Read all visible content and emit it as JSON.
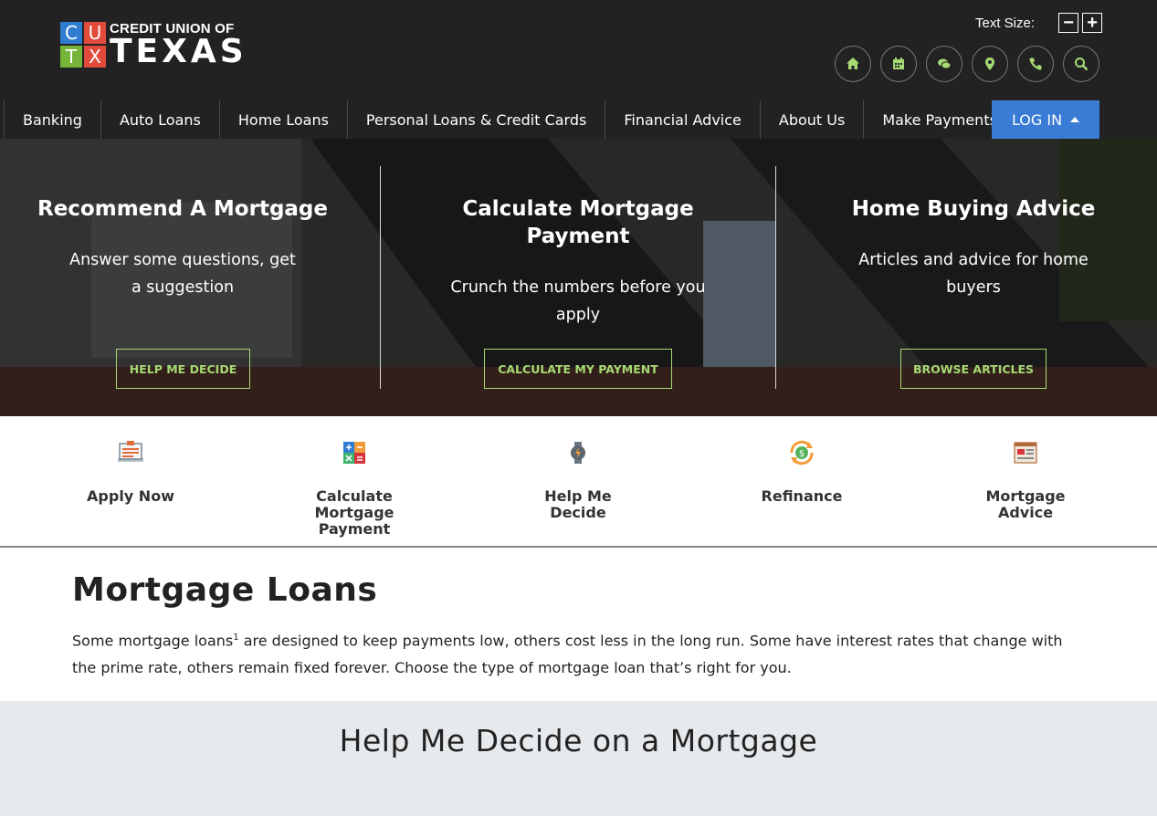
{
  "header": {
    "logo": {
      "cells": [
        "C",
        "U",
        "T",
        "X"
      ],
      "line1": "CREDIT UNION OF",
      "line2": "TEXAS"
    },
    "text_size": {
      "label": "Text Size:",
      "decrease": "−",
      "increase": "+"
    },
    "utility_icons": [
      "home-icon",
      "calendar-icon",
      "chat-icon",
      "location-icon",
      "phone-icon",
      "search-icon"
    ],
    "accent_color": "#a6d974"
  },
  "nav": {
    "items": [
      "Banking",
      "Auto Loans",
      "Home Loans",
      "Personal Loans & Credit Cards",
      "Financial Advice",
      "About Us",
      "Make Payments"
    ],
    "login": "LOG IN",
    "login_color": "#3a7bd5"
  },
  "hero": {
    "columns": [
      {
        "title": "Recommend A Mortgage",
        "text": "Answer some questions, get a suggestion",
        "button": "HELP ME DECIDE"
      },
      {
        "title": "Calculate Mortgage Payment",
        "text": "Crunch the numbers before you apply",
        "button": "CALCULATE MY PAYMENT"
      },
      {
        "title": "Home Buying Advice",
        "text": "Articles and advice for home buyers",
        "button": "BROWSE ARTICLES"
      }
    ]
  },
  "quick_links": [
    {
      "label": "Apply Now",
      "icon": "application-icon"
    },
    {
      "label": "Calculate Mortgage Payment",
      "icon": "calculator-icon"
    },
    {
      "label": "Help Me Decide",
      "icon": "decision-icon"
    },
    {
      "label": "Refinance",
      "icon": "refinance-icon"
    },
    {
      "label": "Mortgage Advice",
      "icon": "advice-icon"
    }
  ],
  "main": {
    "title": "Mortgage Loans",
    "paragraph_before": "Some mortgage loans",
    "footnote": "1",
    "paragraph_after": " are designed to keep payments low, others cost less in the long run. Some have interest rates that change with the prime rate, others remain fixed forever. Choose the type of mortgage loan that’s right for you."
  },
  "help_section": {
    "title": "Help Me Decide on a Mortgage"
  }
}
